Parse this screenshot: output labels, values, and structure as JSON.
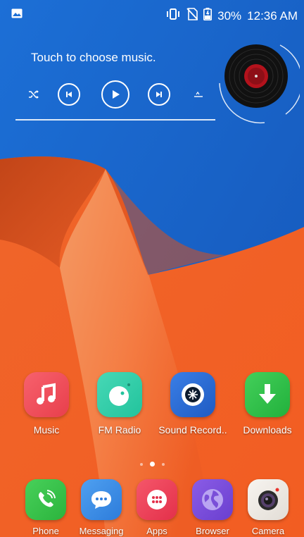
{
  "status_bar": {
    "battery_percent": "30%",
    "time": "12:36 AM",
    "icons": [
      "image-icon",
      "vibrate-icon",
      "no-sim-icon",
      "battery-charging-icon"
    ]
  },
  "music_widget": {
    "prompt": "Touch to choose music.",
    "controls": [
      "shuffle-icon",
      "previous-icon",
      "play-icon",
      "next-icon",
      "playlist-icon"
    ]
  },
  "home_apps": [
    {
      "label": "Music",
      "icon": "music-note-icon",
      "color": "#ef4b57"
    },
    {
      "label": "FM Radio",
      "icon": "radio-dial-icon",
      "color": "#2fcfa9"
    },
    {
      "label": "Sound Record..",
      "icon": "record-icon",
      "color": "#2a6bd6"
    },
    {
      "label": "Downloads",
      "icon": "download-arrow-icon",
      "color": "#2fc04a"
    }
  ],
  "page_indicator": {
    "pages": 3,
    "active": 1
  },
  "dock": [
    {
      "label": "Phone",
      "icon": "phone-icon",
      "color": "#39c24a"
    },
    {
      "label": "Messaging",
      "icon": "chat-bubble-icon",
      "color": "#3b8de6"
    },
    {
      "label": "Apps",
      "icon": "app-grid-icon",
      "color": "#f0405a"
    },
    {
      "label": "Browser",
      "icon": "globe-icon",
      "color": "#7b4fd9"
    },
    {
      "label": "Camera",
      "icon": "camera-lens-icon",
      "color": "#f1ede8"
    }
  ]
}
